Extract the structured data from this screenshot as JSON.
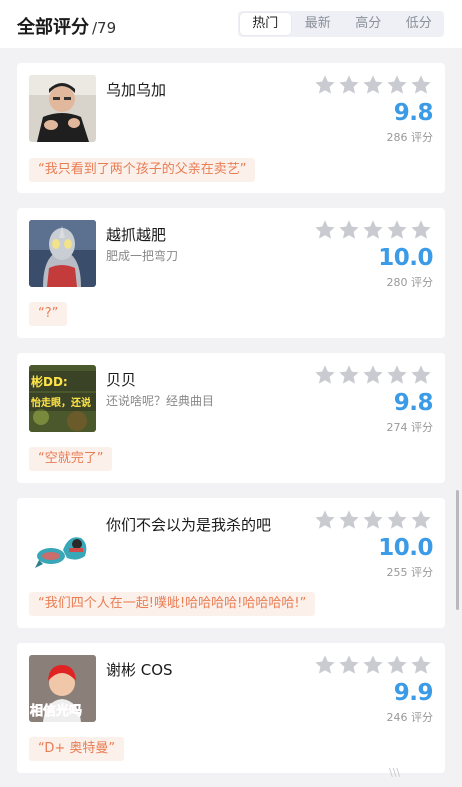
{
  "header": {
    "title": "全部评分",
    "count": "/79",
    "tabs": [
      "热门",
      "最新",
      "高分",
      "低分"
    ],
    "active_tab": 0
  },
  "reviews": [
    {
      "name": "乌加乌加",
      "subtitle": "",
      "score": "9.8",
      "votes": "286 评分",
      "quote": "“我只看到了两个孩子的父亲在卖艺”"
    },
    {
      "name": "越抓越肥",
      "subtitle": "肥成一把弯刀",
      "score": "10.0",
      "votes": "280 评分",
      "quote": "“?”"
    },
    {
      "name": "贝贝",
      "subtitle": "还说啥呢？经典曲目",
      "score": "9.8",
      "votes": "274 评分",
      "quote": "“空就完了”",
      "avatar_text": [
        "彬DD:",
        "怡走眼，还说"
      ]
    },
    {
      "name": "你们不会以为是我杀的吧",
      "subtitle": "",
      "score": "10.0",
      "votes": "255 评分",
      "quote": "“我们四个人在一起!噗呲!哈哈哈哈!哈哈哈哈!”"
    },
    {
      "name": "谢彬 COS",
      "subtitle": "",
      "score": "9.9",
      "votes": "246 评分",
      "quote": "“D+ 奥特曼”",
      "avatar_text": [
        "相信光吗"
      ]
    }
  ],
  "colors": {
    "accent_score": "#3b9be6",
    "quote_text": "#e87d54",
    "quote_bg": "#fcf0ea",
    "star_empty": "#c9cbd1",
    "page_bg": "#f2f2f4"
  },
  "icons": {
    "star": "star-icon"
  },
  "watermark": "\\\\\\"
}
